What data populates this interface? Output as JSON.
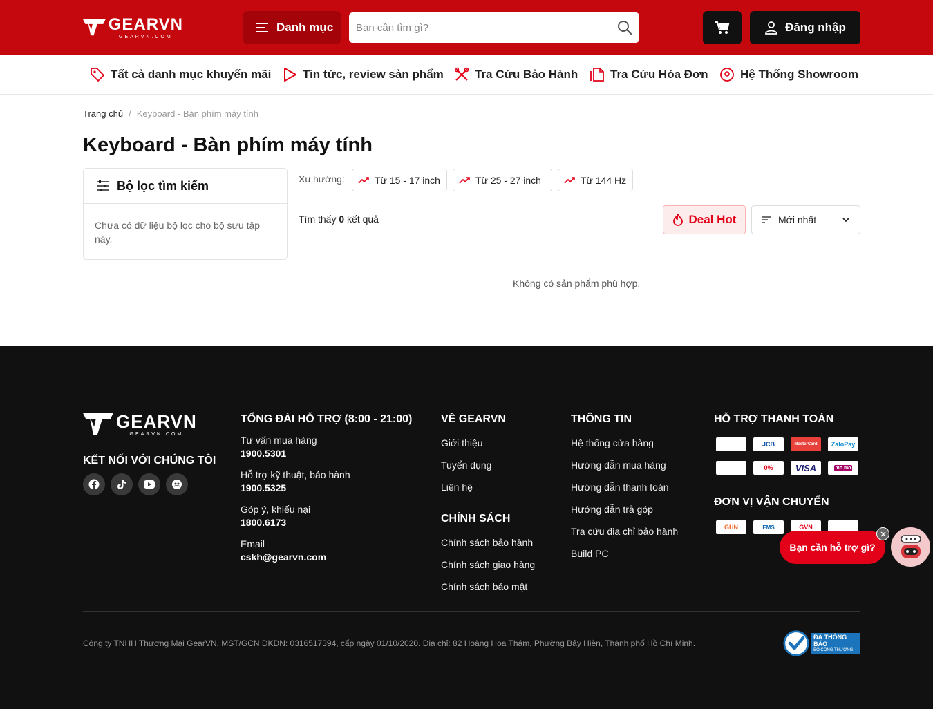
{
  "header": {
    "logo": {
      "name": "GEARVN",
      "sub": "GEARVN.COM"
    },
    "menu_label": "Danh mục",
    "search_placeholder": "Bạn cần tìm gì?",
    "login_label": "Đăng nhập"
  },
  "subnav": [
    {
      "label": "Tất cả danh mục khuyến mãi",
      "icon": "tag-icon"
    },
    {
      "label": "Tin tức, review sản phẩm",
      "icon": "play-icon"
    },
    {
      "label": "Tra Cứu Bảo Hành",
      "icon": "tools-icon"
    },
    {
      "label": "Tra Cứu Hóa Đơn",
      "icon": "document-icon"
    },
    {
      "label": "Hệ Thống Showroom",
      "icon": "location-icon"
    }
  ],
  "breadcrumb": {
    "home": "Trang chủ",
    "separator": "/",
    "current": "Keyboard - Bàn phím máy tính"
  },
  "page_title": "Keyboard - Bàn phím máy tính",
  "filter": {
    "title": "Bộ lọc tìm kiếm",
    "empty_message": "Chưa có dữ liệu bộ lọc cho bộ sưu tập này."
  },
  "trends": {
    "label": "Xu hướng:",
    "chips": [
      "Từ 15 - 17 inch",
      "Từ 25 - 27 inch",
      "Từ 144 Hz"
    ]
  },
  "results": {
    "prefix": "Tìm thấy",
    "count": "0",
    "suffix": "kết quả",
    "empty": "Không có sản phẩm phù hợp."
  },
  "deal_hot_label": "Deal Hot",
  "sort": {
    "selected": "Mới nhất"
  },
  "footer": {
    "logo": {
      "name": "GEARVN",
      "sub": "GEARVN.COM"
    },
    "connect_title": "KẾT NỐI VỚI CHÚNG TÔI",
    "support": {
      "title": "TỔNG ĐÀI HỖ TRỢ (8:00 - 21:00)",
      "items": [
        {
          "label": "Tư vấn mua hàng",
          "value": "1900.5301"
        },
        {
          "label": "Hỗ trợ kỹ thuật, bảo hành",
          "value": "1900.5325"
        },
        {
          "label": "Góp ý, khiếu nại",
          "value": "1800.6173"
        },
        {
          "label": "Email",
          "value": "cskh@gearvn.com"
        }
      ]
    },
    "about": {
      "title": "VỀ GEARVN",
      "links": [
        "Giới thiệu",
        "Tuyển dụng",
        "Liên hệ"
      ]
    },
    "policy": {
      "title": "CHÍNH SÁCH",
      "links": [
        "Chính sách bảo hành",
        "Chính sách giao hàng",
        "Chính sách bảo mật"
      ]
    },
    "info": {
      "title": "THÔNG TIN",
      "links": [
        "Hệ thống cửa hàng",
        "Hướng dẫn mua hàng",
        "Hướng dẫn thanh toán",
        "Hướng dẫn trả góp",
        "Tra cứu địa chỉ bảo hành",
        "Build PC"
      ]
    },
    "payment": {
      "title": "HỖ TRỢ THANH TOÁN",
      "methods": [
        "",
        "JCB",
        "MasterCard",
        "ZaloPay",
        "",
        "0%",
        "VISA",
        "mo mo"
      ]
    },
    "shipping": {
      "title": "ĐƠN VỊ VẬN CHUYỂN",
      "carriers": [
        "GHN",
        "EMS",
        "GVN",
        ""
      ]
    },
    "company": "Công ty TNHH Thương Mại GearVN. MST/GCN ĐKDN: 0316517394, cấp ngày 01/10/2020. Địa chỉ: 82 Hoàng Hoa Thám, Phường Bảy Hiền, Thành phố Hồ Chí Minh.",
    "bct": {
      "line1": "ĐÃ THÔNG BÁO",
      "line2": "BỘ CÔNG THƯƠNG"
    }
  },
  "chat": {
    "label": "Bạn cần hỗ trợ gì?"
  },
  "colors": {
    "brand_red": "#c5080d",
    "dark": "#111111",
    "deal_red": "#e30019"
  }
}
